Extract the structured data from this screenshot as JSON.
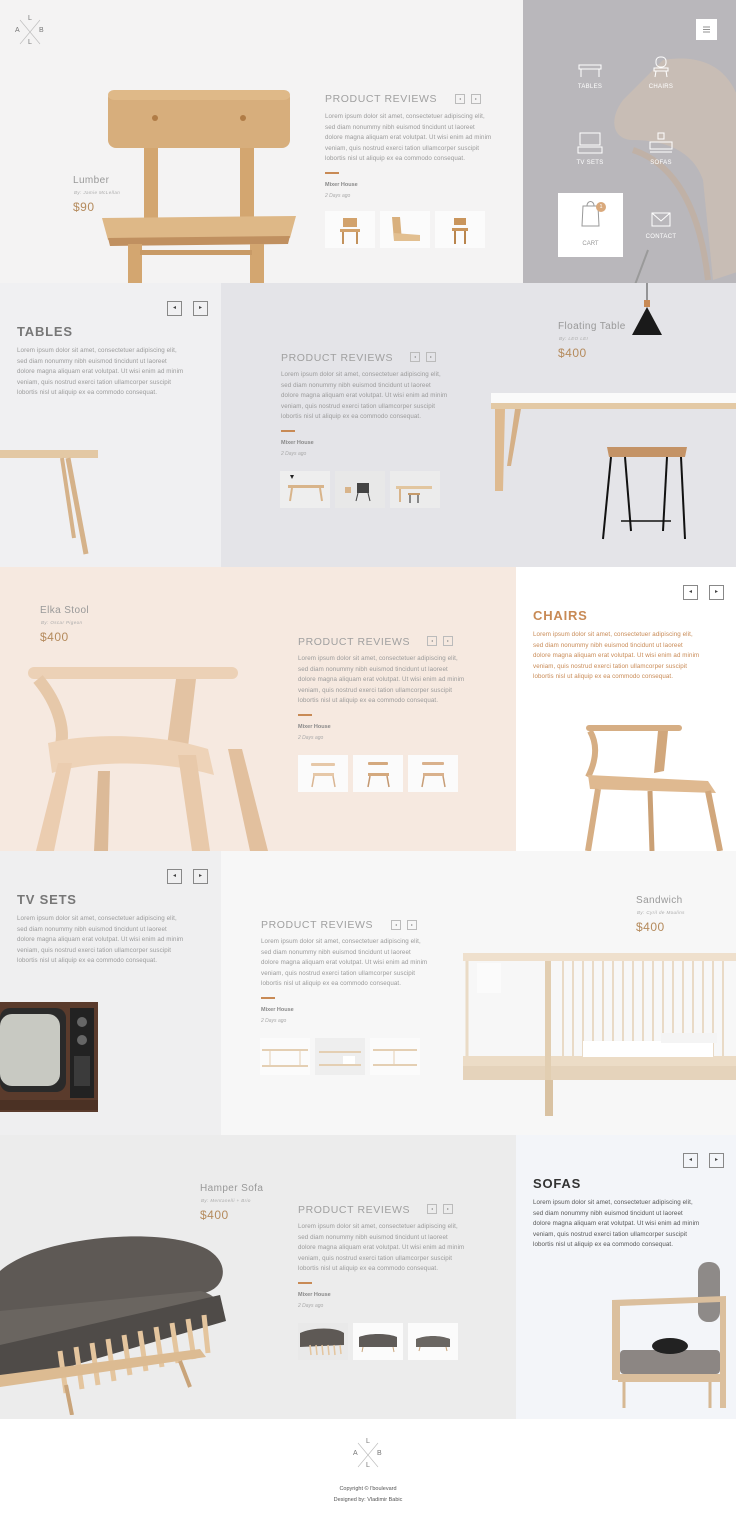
{
  "logo": {
    "letters": [
      "L",
      "A",
      "B",
      "L"
    ]
  },
  "menu": {
    "items": [
      {
        "label": "TABLES",
        "icon": "table-icon"
      },
      {
        "label": "CHAIRS",
        "icon": "chair-icon"
      },
      {
        "label": "TV SETS",
        "icon": "tv-icon"
      },
      {
        "label": "SOFAS",
        "icon": "sofa-icon"
      },
      {
        "label": "CART",
        "icon": "shopping-bag-icon",
        "badge": "1"
      },
      {
        "label": "CONTACT",
        "icon": "envelope-icon"
      }
    ]
  },
  "hero": {
    "product": {
      "name": "Lumber",
      "by": "By:  Jamie McLellan",
      "price": "$90"
    },
    "reviews_title": "PRODUCT REVIEWS",
    "review_text": [
      "Lorem ipsum dolor sit amet, consectetuer adipiscing elit,",
      "sed diam nonummy nibh euismod tincidunt ut laoreet",
      "dolore magna aliquam erat volutpat. Ut wisi enim ad minim",
      "veniam, quis nostrud exerci tation ullamcorper suscipit",
      "lobortis nisl ut aliquip ex ea commodo consequat."
    ],
    "author": "Mixer House",
    "date": "2 Days ago"
  },
  "tables": {
    "title": "TABLES",
    "text": [
      "Lorem ipsum dolor sit amet, consectetuer adipiscing elit,",
      "sed diam nonummy nibh euismod tincidunt ut laoreet",
      "dolore magna aliquam erat volutpat. Ut wisi enim ad minim",
      "veniam, quis nostrud exerci tation ullamcorper suscipit",
      "lobortis nisl ut aliquip ex ea commodo consequat."
    ],
    "product": {
      "name": "Floating Table",
      "by": "By:  LEO LEI",
      "price": "$400"
    },
    "reviews_title": "PRODUCT REVIEWS",
    "review_text": [
      "Lorem ipsum dolor sit amet, consectetuer adipiscing elit,",
      "sed diam nonummy nibh euismod tincidunt ut laoreet",
      "dolore magna aliquam erat volutpat. Ut wisi enim ad minim",
      "veniam, quis nostrud exerci tation ullamcorper suscipit",
      "lobortis nisl ut aliquip ex ea commodo consequat."
    ],
    "author": "Mixer House",
    "date": "2 Days ago"
  },
  "chairs": {
    "title": "CHAIRS",
    "text": [
      "Lorem ipsum dolor sit amet, consectetuer adipiscing elit,",
      "sed diam nonummy nibh euismod tincidunt ut laoreet",
      "dolore magna aliquam erat volutpat. Ut wisi enim ad minim",
      "veniam, quis nostrud exerci tation ullamcorper suscipit",
      "lobortis nisl ut aliquip ex ea commodo consequat."
    ],
    "product": {
      "name": "Elka Stool",
      "by": "By:  Oscar Pigeon",
      "price": "$400"
    },
    "reviews_title": "PRODUCT REVIEWS",
    "review_text": [
      "Lorem ipsum dolor sit amet, consectetuer adipiscing elit,",
      "sed diam nonummy nibh euismod tincidunt ut laoreet",
      "dolore magna aliquam erat volutpat. Ut wisi enim ad minim",
      "veniam, quis nostrud exerci tation ullamcorper suscipit",
      "lobortis nisl ut aliquip ex ea commodo consequat."
    ],
    "author": "Mixer House",
    "date": "2 Days ago"
  },
  "tvsets": {
    "title": "TV SETS",
    "text": [
      "Lorem ipsum dolor sit amet, consectetuer adipiscing elit,",
      "sed diam nonummy nibh euismod tincidunt ut laoreet",
      "dolore magna aliquam erat volutpat. Ut wisi enim ad minim",
      "veniam, quis nostrud exerci tation ullamcorper suscipit",
      "lobortis nisl ut aliquip ex ea commodo consequat."
    ],
    "product": {
      "name": "Sandwich",
      "by": "By:  Cyril de Moulins",
      "price": "$400"
    },
    "reviews_title": "PRODUCT REVIEWS",
    "review_text": [
      "Lorem ipsum dolor sit amet, consectetuer adipiscing elit,",
      "sed diam nonummy nibh euismod tincidunt ut laoreet",
      "dolore magna aliquam erat volutpat. Ut wisi enim ad minim",
      "veniam, quis nostrud exerci tation ullamcorper suscipit",
      "lobortis nisl ut aliquip ex ea commodo consequat."
    ],
    "author": "Mixer House",
    "date": "2 Days ago"
  },
  "sofas": {
    "title": "SOFAS",
    "text": [
      "Lorem ipsum dolor sit amet, consectetuer adipiscing elit,",
      "sed diam nonummy nibh euismod tincidunt ut laoreet",
      "dolore magna aliquam erat volutpat. Ut wisi enim ad minim",
      "veniam, quis nostrud exerci tation ullamcorper suscipit",
      "lobortis nisl ut aliquip ex ea commodo consequat."
    ],
    "product": {
      "name": "Hamper Sofa",
      "by": "By:  Mentanelli + Brio",
      "price": "$400"
    },
    "reviews_title": "PRODUCT REVIEWS",
    "review_text": [
      "Lorem ipsum dolor sit amet, consectetuer adipiscing elit,",
      "sed diam nonummy nibh euismod tincidunt ut laoreet",
      "dolore magna aliquam erat volutpat. Ut wisi enim ad minim",
      "veniam, quis nostrud exerci tation ullamcorper suscipit",
      "lobortis nisl ut aliquip ex ea commodo consequat."
    ],
    "author": "Mixer House",
    "date": "2 Days ago"
  },
  "footer": {
    "copyright": "Copyright © l'boulevard",
    "designed": "Designed by: Vladimir Babic"
  },
  "colors": {
    "accent": "#c88a55",
    "price": "#b58b5d",
    "menu_bg": "#b9b7bb"
  }
}
